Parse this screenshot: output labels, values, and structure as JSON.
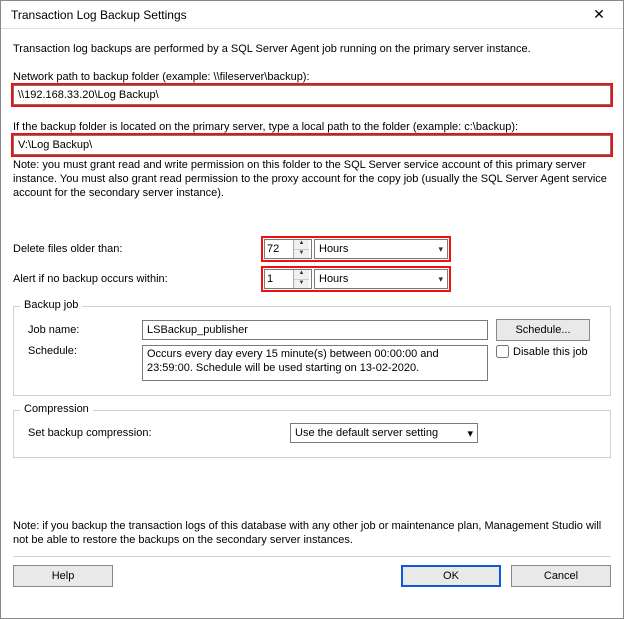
{
  "window": {
    "title": "Transaction Log Backup Settings"
  },
  "desc": "Transaction log backups are performed by a SQL Server Agent job running on the primary server instance.",
  "network_path": {
    "label": "Network path to backup folder (example: \\\\fileserver\\backup):",
    "value": "\\\\192.168.33.20\\Log Backup\\"
  },
  "local_path": {
    "label": "If the backup folder is located on the primary server, type a local path to the folder (example: c:\\backup):",
    "value": "V:\\Log Backup\\"
  },
  "perm_note": "Note: you must grant read and write permission on this folder to the SQL Server service account of this primary server instance.   You must also grant read permission to the proxy account for the copy job (usually the SQL Server Agent service account for the secondary server instance).",
  "delete_older": {
    "label": "Delete files older than:",
    "value": "72",
    "unit": "Hours"
  },
  "alert_within": {
    "label": "Alert if no backup occurs within:",
    "value": "1",
    "unit": "Hours"
  },
  "backup_job": {
    "legend": "Backup job",
    "job_name_label": "Job name:",
    "job_name_value": "LSBackup_publisher",
    "schedule_btn": "Schedule...",
    "schedule_label": "Schedule:",
    "schedule_text": "Occurs every day every 15 minute(s) between 00:00:00 and 23:59:00. Schedule will be used starting on 13-02-2020.",
    "disable_label": "Disable this job"
  },
  "compression": {
    "legend": "Compression",
    "label": "Set backup compression:",
    "value": "Use the default server setting"
  },
  "footer_note": "Note: if you backup the transaction logs of this database with any other job or maintenance plan, Management Studio will not be able to restore the backups on the secondary server instances.",
  "buttons": {
    "help": "Help",
    "ok": "OK",
    "cancel": "Cancel"
  }
}
